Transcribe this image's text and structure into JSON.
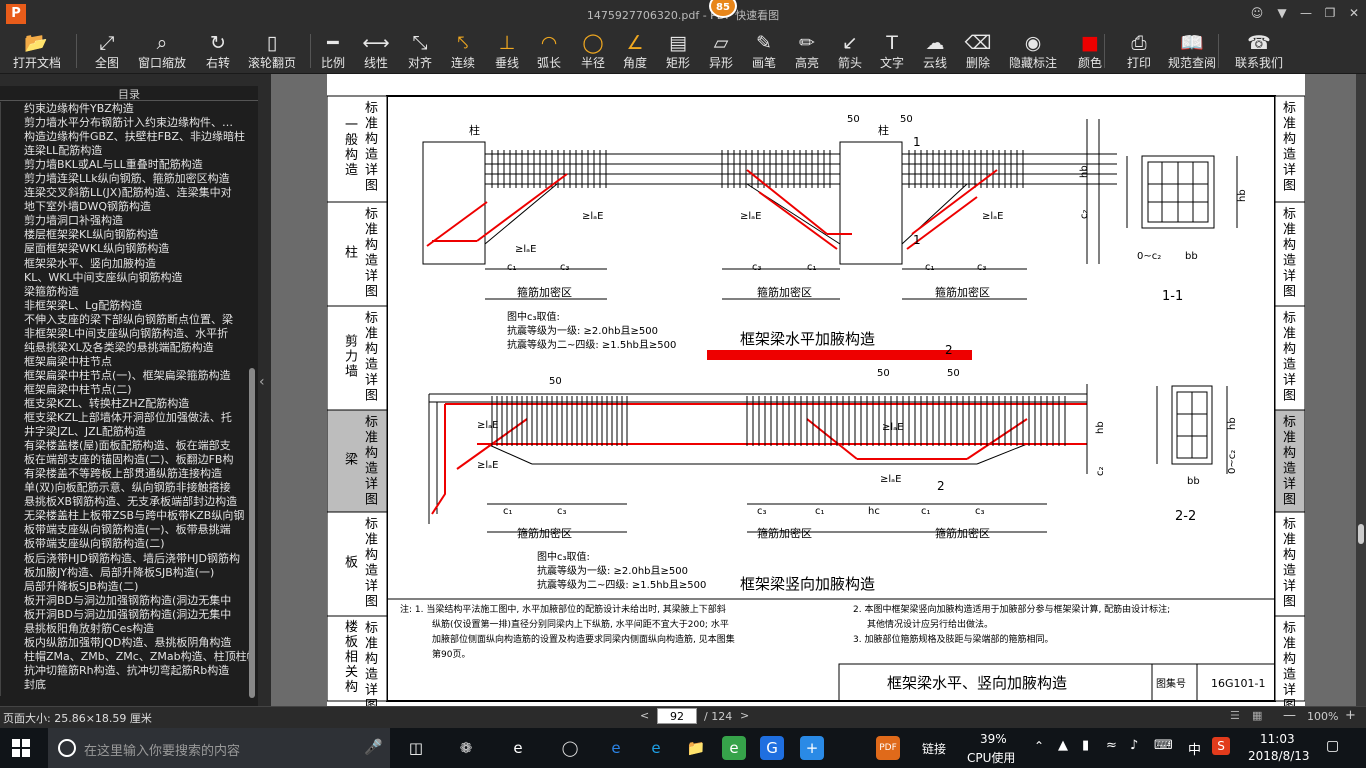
{
  "window": {
    "title": "1475927706320.pdf - PDF 快速看图",
    "badge": "85",
    "logo": "P"
  },
  "toolbar": [
    {
      "label": "打开文档",
      "icon": "folder-icon"
    },
    {
      "label": "全图",
      "icon": "fullscreen-icon"
    },
    {
      "label": "窗口缩放",
      "icon": "magnifier-icon"
    },
    {
      "label": "右转",
      "icon": "rotate-right-icon"
    },
    {
      "label": "滚轮翻页",
      "icon": "mouse-wheel-icon"
    },
    {
      "label": "比例",
      "icon": "scale-icon"
    },
    {
      "label": "线性",
      "icon": "linear-measure-icon"
    },
    {
      "label": "对齐",
      "icon": "aligned-measure-icon"
    },
    {
      "label": "连续",
      "icon": "continuous-measure-icon"
    },
    {
      "label": "垂线",
      "icon": "perpendicular-icon"
    },
    {
      "label": "弧长",
      "icon": "arc-length-icon"
    },
    {
      "label": "半径",
      "icon": "radius-icon"
    },
    {
      "label": "角度",
      "icon": "angle-icon"
    },
    {
      "label": "矩形",
      "icon": "rectangle-area-icon"
    },
    {
      "label": "异形",
      "icon": "polygon-area-icon"
    },
    {
      "label": "画笔",
      "icon": "pen-icon"
    },
    {
      "label": "高亮",
      "icon": "highlighter-icon"
    },
    {
      "label": "箭头",
      "icon": "arrow-icon"
    },
    {
      "label": "文字",
      "icon": "text-icon"
    },
    {
      "label": "云线",
      "icon": "cloud-line-icon"
    },
    {
      "label": "删除",
      "icon": "eraser-icon"
    },
    {
      "label": "隐藏标注",
      "icon": "hide-eye-icon"
    },
    {
      "label": "颜色",
      "icon": "color-swatch-icon"
    },
    {
      "label": "打印",
      "icon": "printer-icon"
    },
    {
      "label": "规范查阅",
      "icon": "book-icon"
    },
    {
      "label": "联系我们",
      "icon": "support-icon"
    }
  ],
  "sidebar": {
    "title": "目录",
    "items": [
      "约束边缘构件YBZ构造",
      "剪力墙水平分布钢筋计入约束边缘构件、…",
      "构造边缘构件GBZ、扶壁柱FBZ、非边缘暗柱",
      "连梁LL配筋构造",
      "剪力墙BKL或AL与LL重叠时配筋构造",
      "剪力墙连梁LLk纵向钢筋、箍筋加密区构造",
      "连梁交叉斜筋LL(JX)配筋构造、连梁集中对",
      "地下室外墙DWQ钢筋构造",
      "剪力墙洞口补强构造",
      "楼层框架梁KL纵向钢筋构造",
      "屋面框架梁WKL纵向钢筋构造",
      "框架梁水平、竖向加腋构造",
      "KL、WKL中间支座纵向钢筋构造",
      "梁箍筋构造",
      "非框架梁L、Lg配筋构造",
      "不伸入支座的梁下部纵向钢筋断点位置、梁",
      "非框架梁L中间支座纵向钢筋构造、水平折",
      "纯悬挑梁XL及各类梁的悬挑端配筋构造",
      "框架扁梁中柱节点",
      "框架扁梁中柱节点(一)、框架扁梁箍筋构造",
      "框架扁梁中柱节点(二)",
      "框支梁KZL、转换柱ZHZ配筋构造",
      "框支梁KZL上部墙体开洞部位加强做法、托",
      "井字梁JZL、JZL配筋构造",
      "有梁楼盖楼(屋)面板配筋构造、板在端部支",
      "板在端部支座的锚固构造(二)、板翻边FB构",
      "有梁楼盖不等跨板上部贯通纵筋连接构造",
      "单(双)向板配筋示意、纵向钢筋非接触搭接",
      "悬挑板XB钢筋构造、无支承板端部封边构造",
      "无梁楼盖柱上板带ZSB与跨中板带KZB纵向钢",
      "板带端支座纵向钢筋构造(一)、板带悬挑端",
      "板带端支座纵向钢筋构造(二)",
      "板后浇带HJD钢筋构造、墙后浇带HJD钢筋构",
      "板加腋JY构造、局部升降板SJB构造(一)",
      "局部升降板SJB构造(二)",
      "板开洞BD与洞边加强钢筋构造(洞边无集中",
      "板开洞BD与洞边加强钢筋构造(洞边无集中",
      "悬挑板阳角放射筋Ces构造",
      "板内纵筋加强带JQD构造、悬挑板阴角构造",
      "柱帽ZMa、ZMb、ZMc、ZMab构造、柱顶柱帽",
      "抗冲切箍筋Rh构造、抗冲切弯起筋Rb构造",
      "封底"
    ]
  },
  "drawing": {
    "left_tabs": [
      {
        "label": "标准构造详图",
        "section": "一般构造"
      },
      {
        "label": "标准构造详图",
        "section": "柱"
      },
      {
        "label": "标准构造详图",
        "section": "剪力墙"
      },
      {
        "label": "标准构造详图",
        "section": "梁"
      },
      {
        "label": "标准构造详图",
        "section": "板"
      },
      {
        "label": "标准构造详图",
        "section": "楼板相关构"
      }
    ],
    "right_tabs": [
      "标准构造详图",
      "标准构造详图",
      "标准构造详图",
      "标准构造详图",
      "标准构造详图",
      "标准构造详图"
    ],
    "top_title": "框架梁水平加腋构造",
    "bottom_title": "框架梁竖向加腋构造",
    "column_label": "柱",
    "dense_zone": "箍筋加密区",
    "c3_note": [
      "图中c₃取值:",
      "抗震等级为一级: ≥2.0hb且≥500",
      "抗震等级为二~四级: ≥1.5hb且≥500"
    ],
    "section_labels": [
      "1-1",
      "2-2"
    ],
    "dims": {
      "d50": "50",
      "c1": "c₁",
      "c2": "c₂",
      "c3": "c₃",
      "lae": "≥lₐE",
      "hb": "hb",
      "bb": "bb",
      "hc": "hc",
      "sec1": "1",
      "sec2": "2",
      "c2b": "0~c₂"
    },
    "notes": [
      "注: 1. 当梁结构平法施工图中, 水平加腋部位的配筋设计未给出时, 其梁腋上下部斜",
      "纵筋(仅设置第一排)直径分别同梁内上下纵筋, 水平间距不宜大于200; 水平",
      "加腋部位侧面纵向构造筋的设置及构造要求同梁内侧面纵向构造筋, 见本图集",
      "第90页。",
      "2. 本图中框架梁竖向加腋构造适用于加腋部分参与框架梁计算, 配筋由设计标注;",
      "其他情况设计应另行给出做法。",
      "3. 加腋部位箍筋规格及肢距与梁端部的箍筋相同。"
    ],
    "title_block": {
      "title": "框架梁水平、竖向加腋构造",
      "atlas_label": "图集号",
      "atlas_no": "16G101-1"
    }
  },
  "status": {
    "page_size": "页面大小: 25.86×18.59 厘米",
    "page": "92",
    "total": "/ 124",
    "zoom": "100%"
  },
  "taskbar": {
    "search_placeholder": "在这里输入你要搜索的内容",
    "link": "链接",
    "cpu_pct": "39%",
    "cpu_label": "CPU使用",
    "ime": "中",
    "time": "11:03",
    "date": "2018/8/13"
  }
}
